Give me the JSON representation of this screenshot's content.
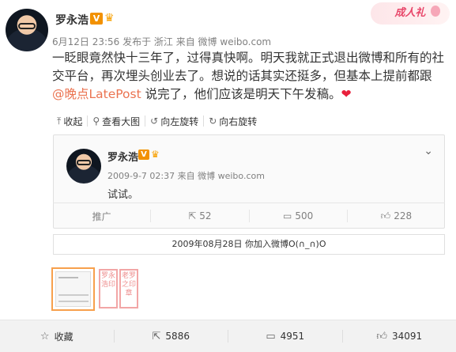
{
  "post": {
    "author": "罗永浩",
    "verified_mark": "V",
    "meta": "6月12日 23:56 发布于 浙江 来自 微博 weibo.com",
    "text_before_mention": "一眨眼竟然快十三年了，过得真快啊。明天我就正式退出微博和所有的社交平台，再次埋头创业去了。想说的话其实还挺多，但基本上提前都跟 ",
    "mention": "@晚点LatePost",
    "text_after_mention": " 说完了，他们应该是明天下午发稿。",
    "heart": "❤",
    "corner_badge": "成人礼"
  },
  "toolbar": {
    "collapse": "收起",
    "view_large": "查看大图",
    "rotate_left": "向左旋转",
    "rotate_right": "向右旋转"
  },
  "repost_card": {
    "author": "罗永浩",
    "verified_mark": "V",
    "meta": "2009-9-7 02:37 来自 微博 weibo.com",
    "text": "试试。",
    "actions": {
      "promote": "推广",
      "reposts": "52",
      "comments": "500",
      "likes": "228"
    }
  },
  "join_bar": "2009年08月28日 你加入微博O(∩_∩)O",
  "bottom_bar": {
    "favorite": "收藏",
    "reposts": "5886",
    "comments": "4951",
    "likes": "34091"
  },
  "colors": {
    "accent": "#eb7350",
    "verified": "#f29100",
    "heart": "#e8203c"
  }
}
